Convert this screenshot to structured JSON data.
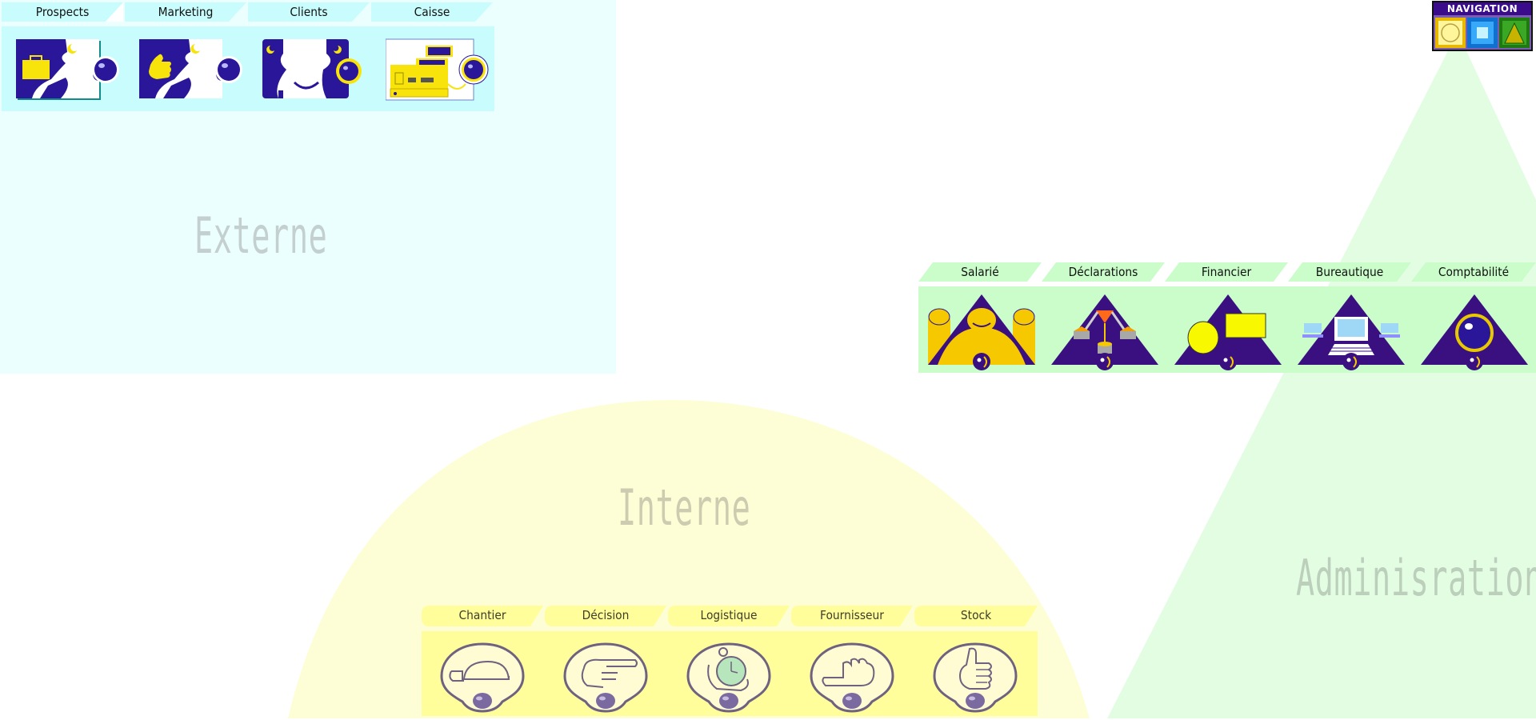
{
  "colors": {
    "externe_bg": "#ebfffe",
    "externe_tabs": "#c9fdfd",
    "interne_bg": "#fefed6",
    "interne_tabs": "#fffe9a",
    "admin_bg": "#e3fde3",
    "admin_tabs": "#cafdca",
    "icon_purple": "#2a1699",
    "icon_yellow": "#f8e40a"
  },
  "zones": {
    "externe": {
      "title": "Externe"
    },
    "interne": {
      "title": "Interne"
    },
    "administration": {
      "title": "Adminisration"
    }
  },
  "navigation": {
    "title": "NAVIGATION",
    "buttons": [
      {
        "name": "circle",
        "icon": "circle-icon",
        "color": "#f5d21a"
      },
      {
        "name": "square",
        "icon": "square-icon",
        "color": "#1a8ce6"
      },
      {
        "name": "triangle",
        "icon": "triangle-icon",
        "color": "#2c9a14"
      }
    ]
  },
  "externe": {
    "items": [
      {
        "label": "Prospects",
        "icon": "briefcase-puzzle-icon"
      },
      {
        "label": "Marketing",
        "icon": "thumbs-up-puzzle-icon"
      },
      {
        "label": "Clients",
        "icon": "handshake-puzzle-icon"
      },
      {
        "label": "Caisse",
        "icon": "cash-register-icon"
      }
    ]
  },
  "administration": {
    "items": [
      {
        "label": "Salarié",
        "icon": "employees-icon"
      },
      {
        "label": "Déclarations",
        "icon": "balance-scale-icon"
      },
      {
        "label": "Financier",
        "icon": "finance-shapes-icon"
      },
      {
        "label": "Bureautique",
        "icon": "computer-icon"
      },
      {
        "label": "Comptabilité",
        "icon": "accounting-ring-icon"
      }
    ]
  },
  "interne": {
    "items": [
      {
        "label": "Chantier",
        "icon": "hand-helmet-icon"
      },
      {
        "label": "Décision",
        "icon": "pointing-hand-icon"
      },
      {
        "label": "Logistique",
        "icon": "hand-stopwatch-icon"
      },
      {
        "label": "Fournisseur",
        "icon": "fist-hand-icon"
      },
      {
        "label": "Stock",
        "icon": "thumbs-up-icon"
      }
    ]
  }
}
